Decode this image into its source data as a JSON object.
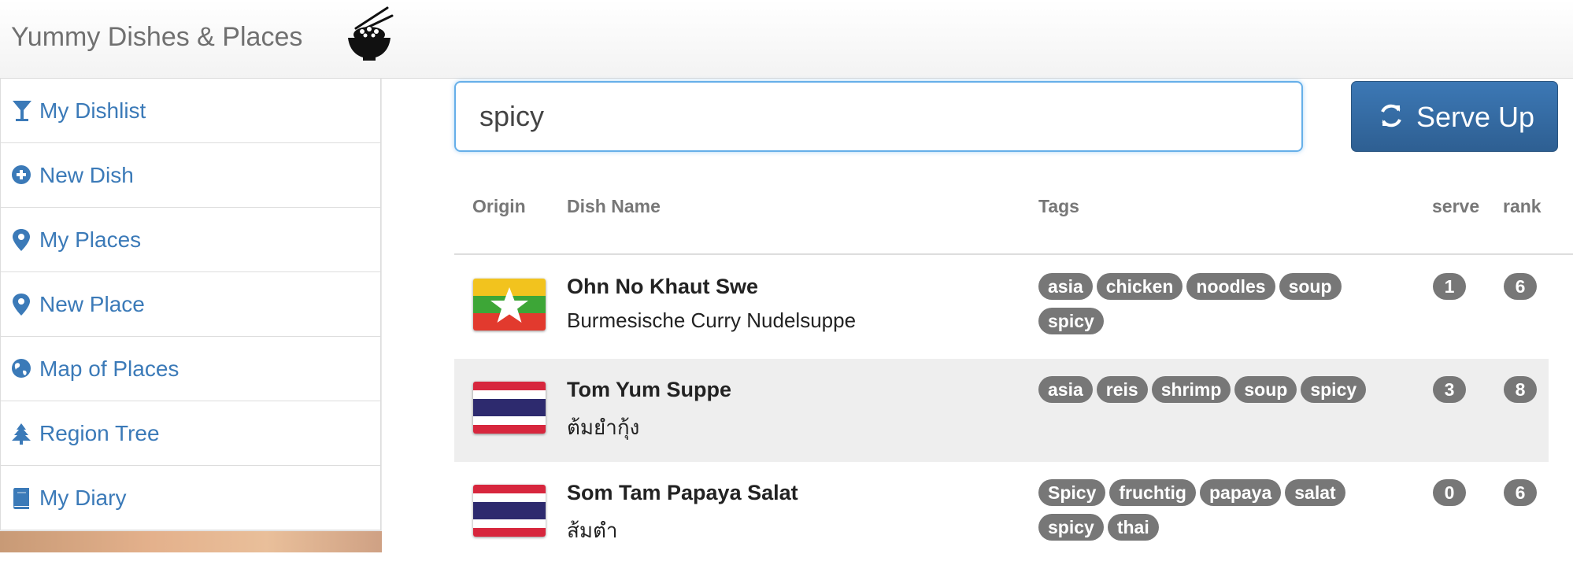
{
  "app": {
    "title": "Yummy Dishes & Places",
    "logo_icon": "rice-bowl-chopsticks-icon"
  },
  "sidebar": {
    "items": [
      {
        "label": "My Dishlist",
        "icon": "cocktail-glass-icon"
      },
      {
        "label": "New Dish",
        "icon": "plus-circle-icon"
      },
      {
        "label": "My Places",
        "icon": "map-marker-icon"
      },
      {
        "label": "New Place",
        "icon": "map-marker-icon"
      },
      {
        "label": "Map of Places",
        "icon": "globe-icon"
      },
      {
        "label": "Region Tree",
        "icon": "tree-icon"
      },
      {
        "label": "My Diary",
        "icon": "book-icon"
      }
    ]
  },
  "search": {
    "value": "spicy",
    "placeholder": ""
  },
  "serve_button": {
    "label": "Serve Up",
    "icon": "refresh-icon",
    "color": "#337ab7"
  },
  "table": {
    "headers": {
      "origin": "Origin",
      "dish_name": "Dish Name",
      "tags": "Tags",
      "serve": "serve",
      "rank": "rank"
    },
    "rows": [
      {
        "flag": "myanmar-flag",
        "name": "Ohn No Khaut Swe",
        "subtitle": "Burmesische Curry Nudelsuppe",
        "tags": [
          "asia",
          "chicken",
          "noodles",
          "soup",
          "spicy"
        ],
        "serve": "1",
        "rank": "6"
      },
      {
        "flag": "thailand-flag",
        "name": "Tom Yum Suppe",
        "subtitle": "ต้มยำกุ้ง",
        "tags": [
          "asia",
          "reis",
          "shrimp",
          "soup",
          "spicy"
        ],
        "serve": "3",
        "rank": "8"
      },
      {
        "flag": "thailand-flag",
        "name": "Som Tam Papaya Salat",
        "subtitle": "ส้มตำ",
        "tags": [
          "Spicy",
          "fruchtig",
          "papaya",
          "salat",
          "spicy",
          "thai"
        ],
        "serve": "0",
        "rank": "6"
      }
    ]
  },
  "colors": {
    "link": "#3b7ab8",
    "badge": "#777777",
    "focus_border": "#66afe9"
  }
}
